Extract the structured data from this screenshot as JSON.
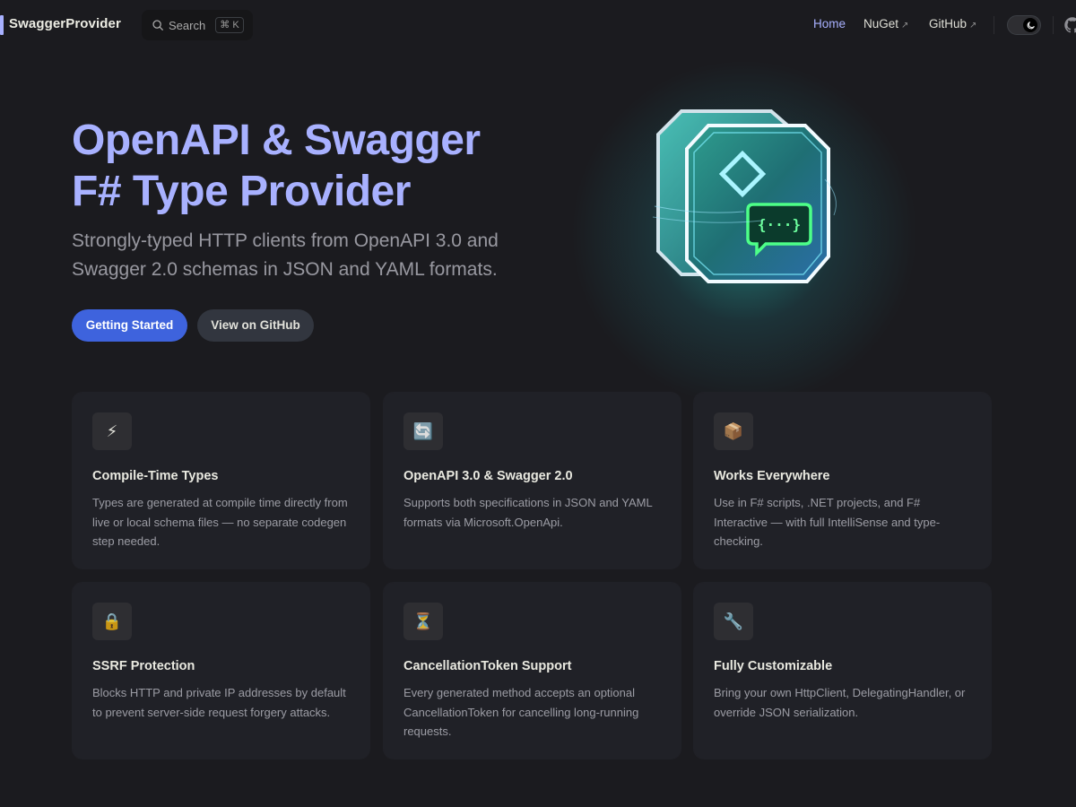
{
  "nav": {
    "site_title": "SwaggerProvider",
    "search_label": "Search",
    "search_shortcut": "⌘ K",
    "links": [
      {
        "label": "Home",
        "active": true,
        "external": false
      },
      {
        "label": "NuGet",
        "active": false,
        "external": true
      },
      {
        "label": "GitHub",
        "active": false,
        "external": true
      }
    ],
    "external_marker": "↗",
    "theme_toggle_icon": "moon-icon"
  },
  "hero": {
    "name_line1": "OpenAPI & Swagger",
    "name_line2": "F# Type Provider",
    "tagline": "Strongly-typed HTTP clients from OpenAPI 3.0 and Swagger 2.0 schemas in JSON and YAML formats.",
    "actions": [
      {
        "label": "Getting Started",
        "theme": "brand"
      },
      {
        "label": "View on GitHub",
        "theme": "alt"
      }
    ],
    "image_icon": "openapi-cube-icon",
    "image_code_text": "{···}"
  },
  "features": [
    {
      "icon": "⚡",
      "icon_name": "lightning-icon",
      "title": "Compile-Time Types",
      "details": "Types are generated at compile time directly from live or local schema files — no separate codegen step needed."
    },
    {
      "icon": "🔄",
      "icon_name": "arrows-cycle-icon",
      "title": "OpenAPI 3.0 & Swagger 2.0",
      "details": "Supports both specifications in JSON and YAML formats via Microsoft.OpenApi."
    },
    {
      "icon": "📦",
      "icon_name": "package-icon",
      "title": "Works Everywhere",
      "details": "Use in F# scripts, .NET projects, and F# Interactive — with full IntelliSense and type-checking."
    },
    {
      "icon": "🔒",
      "icon_name": "lock-icon",
      "title": "SSRF Protection",
      "details": "Blocks HTTP and private IP addresses by default to prevent server-side request forgery attacks."
    },
    {
      "icon": "⏳",
      "icon_name": "hourglass-icon",
      "title": "CancellationToken Support",
      "details": "Every generated method accepts an optional CancellationToken for cancelling long-running requests."
    },
    {
      "icon": "🔧",
      "icon_name": "wrench-icon",
      "title": "Fully Customizable",
      "details": "Bring your own HttpClient, DelegatingHandler, or override JSON serialization."
    }
  ],
  "colors": {
    "background": "#1b1b1f",
    "brand": "#a8b1ff",
    "button_brand": "#3e63dd",
    "card": "#202127"
  }
}
